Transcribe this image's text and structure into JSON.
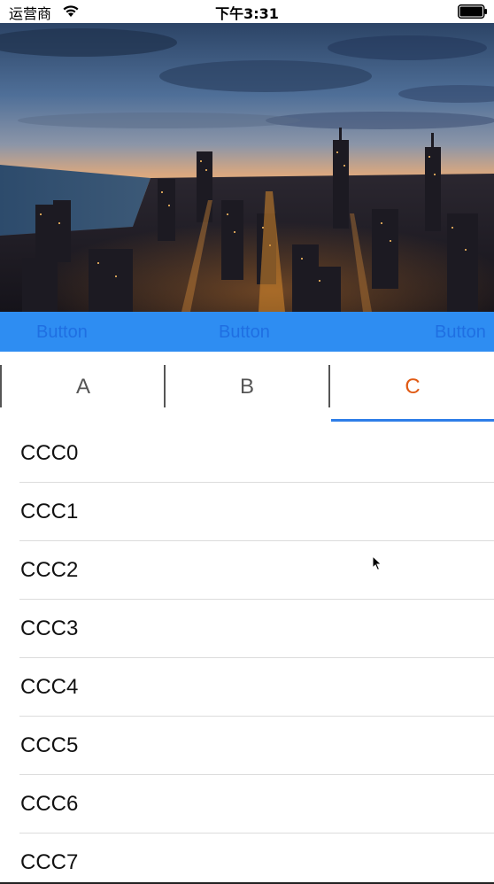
{
  "status_bar": {
    "carrier": "运营商",
    "time": "下午3:31",
    "wifi_icon": "wifi-icon",
    "battery_icon": "battery-icon"
  },
  "hero": {
    "image": "city-skyline-at-dusk"
  },
  "button_bar": {
    "background": "#2e8df2",
    "text_color": "#1f6fe2",
    "buttons": [
      {
        "label": "Button"
      },
      {
        "label": "Button"
      },
      {
        "label": "Button"
      }
    ]
  },
  "tabs": {
    "items": [
      {
        "label": "A"
      },
      {
        "label": "B"
      },
      {
        "label": "C"
      }
    ],
    "selected": "C",
    "selected_color": "#e05a14",
    "indicator_color": "#2e7ee8"
  },
  "list": {
    "items": [
      "CCC0",
      "CCC1",
      "CCC2",
      "CCC3",
      "CCC4",
      "CCC5",
      "CCC6",
      "CCC7"
    ]
  }
}
